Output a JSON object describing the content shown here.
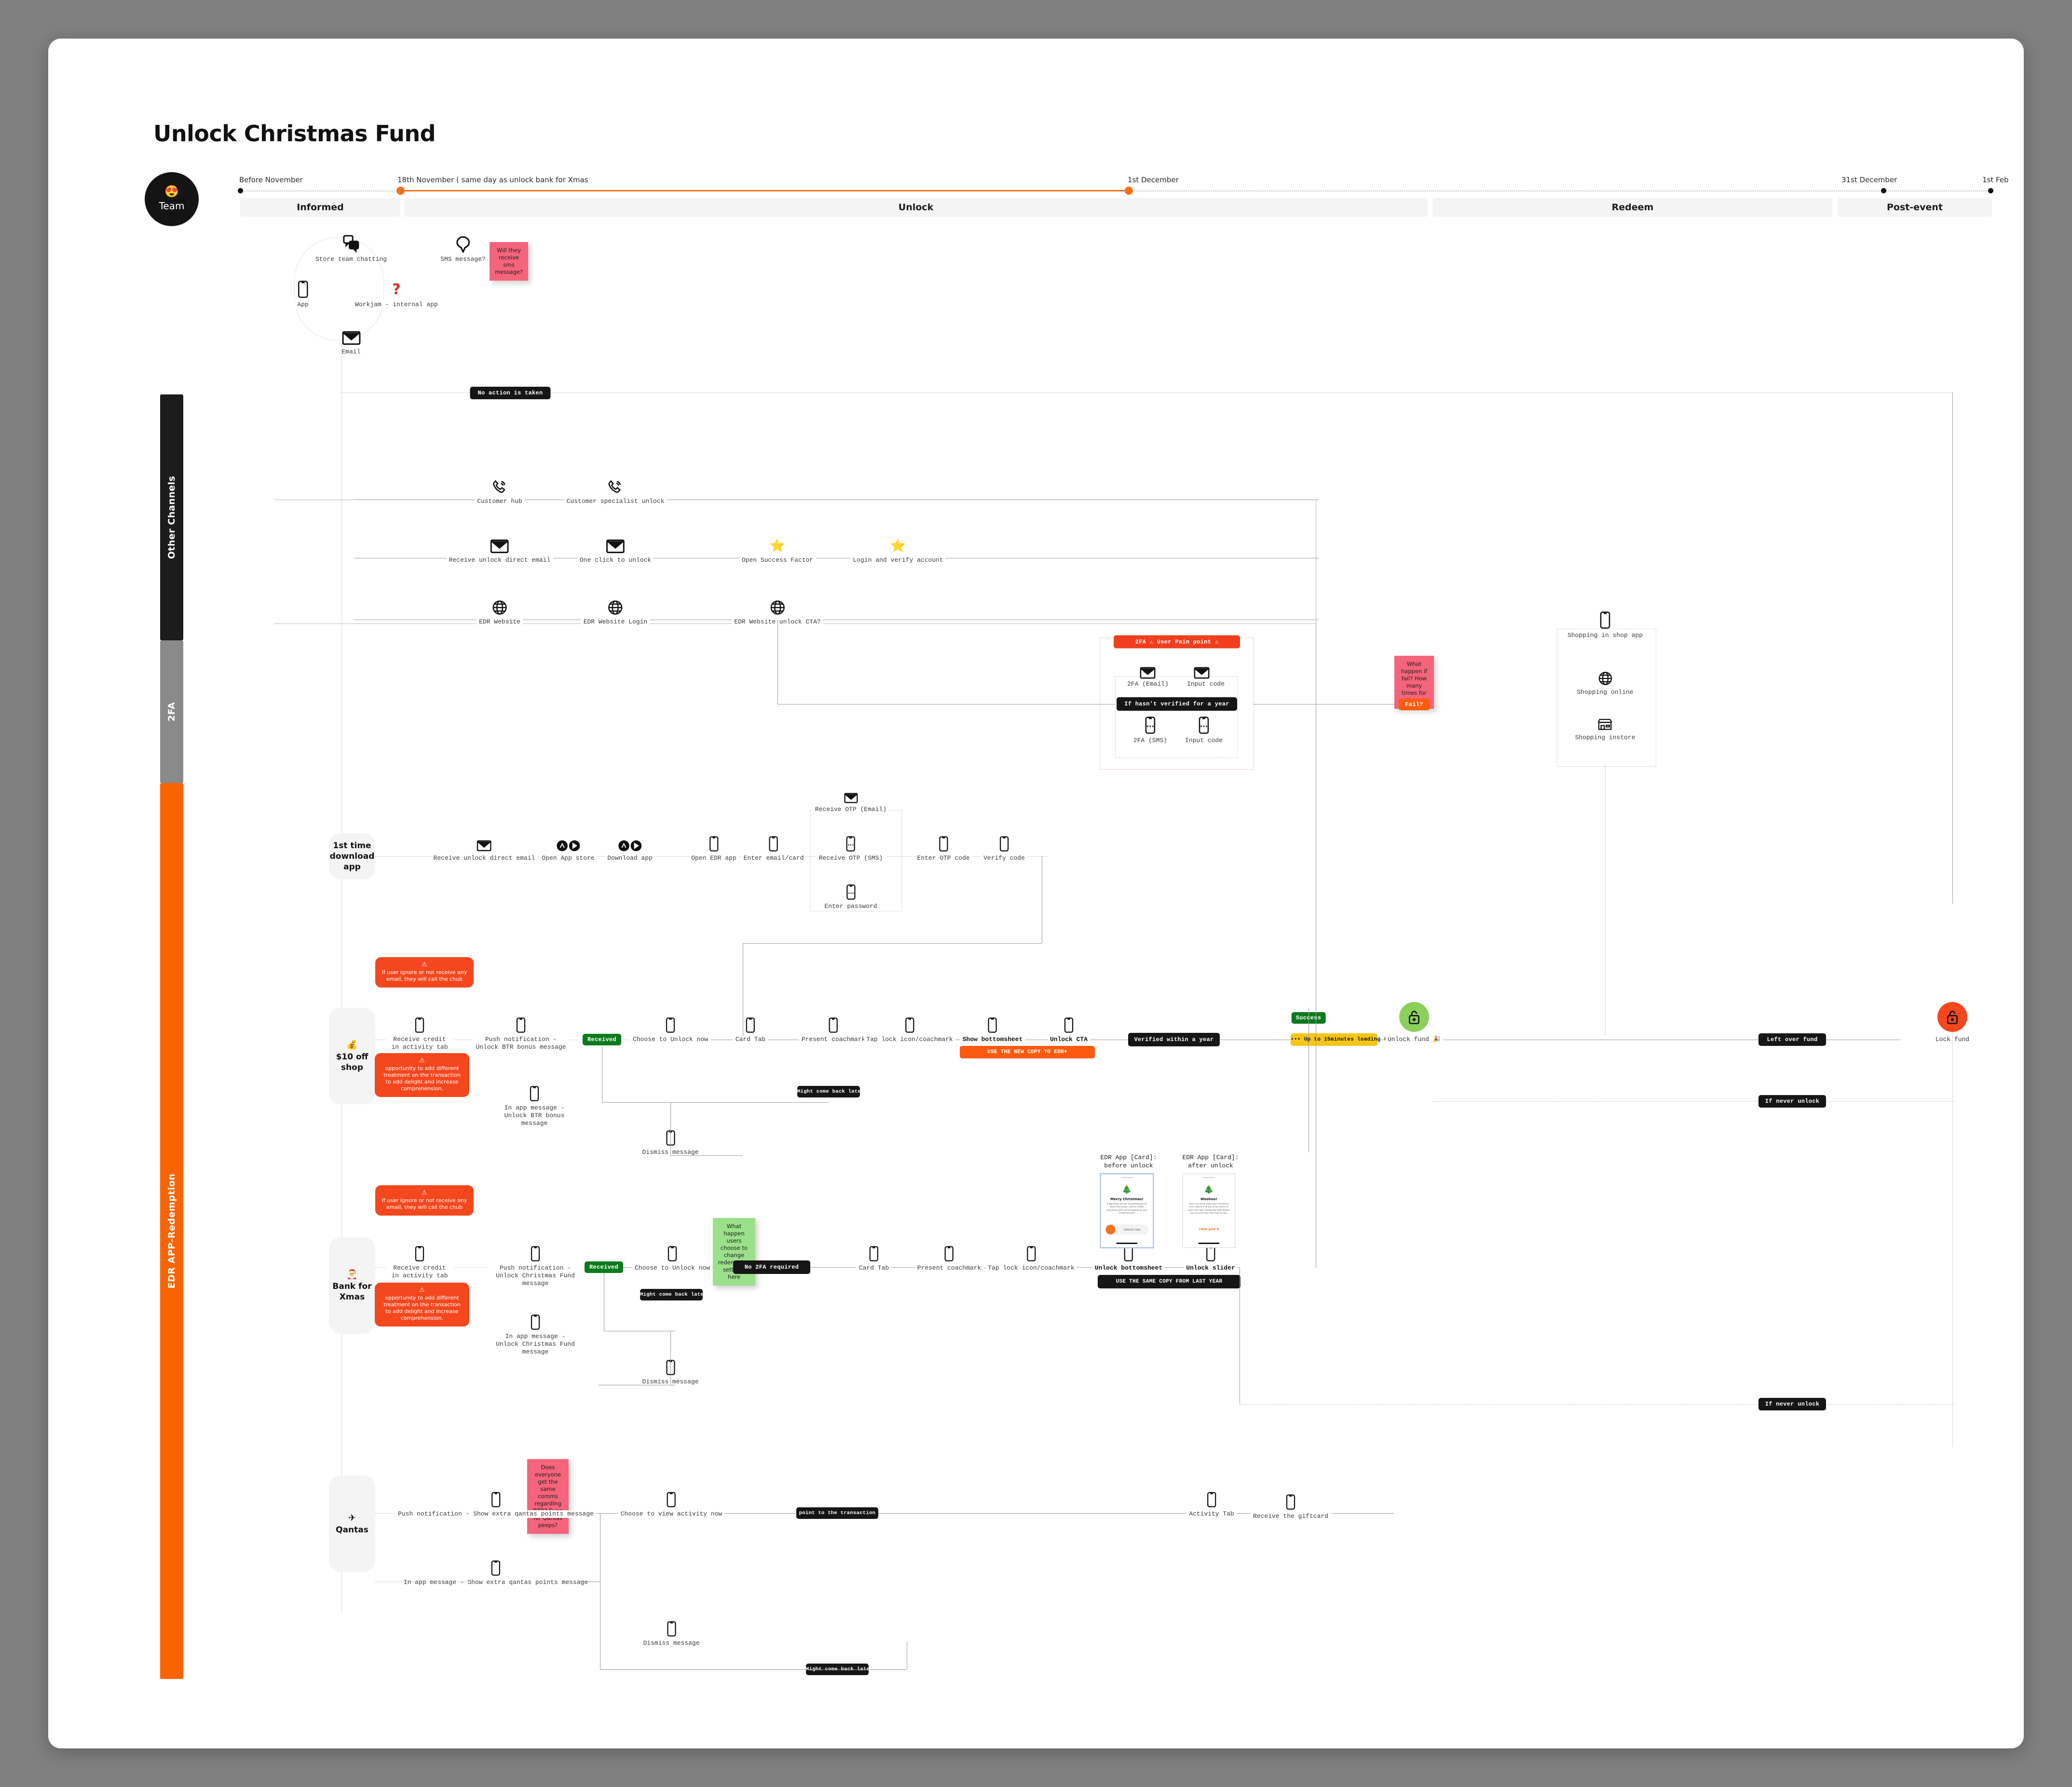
{
  "board": {
    "title": "Unlock Christmas Fund",
    "team": {
      "emoji": "😍",
      "label": "Team"
    }
  },
  "timeline": {
    "dates": [
      "Before November",
      "18th November ( same day as unlock bank for Xmas",
      "1st December",
      "31st December",
      "1st Feb"
    ],
    "phases": [
      "Informed",
      "Unlock",
      "Redeem",
      "Post-event"
    ],
    "accent": "#F2711C"
  },
  "lanes": [
    {
      "name": "Other  Channels",
      "color": "#1c1c1c"
    },
    {
      "name": "2FA",
      "color": "#8a8a8a"
    },
    {
      "name": "EDR APP-Redemption",
      "color": "#FA6400"
    }
  ],
  "informed": {
    "nodes": [
      {
        "icon": "chat-icon",
        "label": "Store team chatting"
      },
      {
        "icon": "phone-icon",
        "label": "App"
      },
      {
        "icon": "workjam-icon",
        "label": "Workjam - internal app"
      },
      {
        "icon": "email-icon",
        "label": "Email"
      },
      {
        "icon": "sms-bubble-icon",
        "label": "SMS message?"
      }
    ],
    "sticky": "Will they receive sms message?",
    "question_mark": "?"
  },
  "other_channels": {
    "badge_no_action": "No action is taken",
    "rows": [
      {
        "icon": "call-icon",
        "steps": [
          "Customer hub",
          "Customer specialist unlock"
        ]
      },
      {
        "icon": "email-icon",
        "steps": [
          "Receive unlock direct email",
          "One click to unlock",
          "Open Success Factor",
          "Login and verify account"
        ]
      },
      {
        "icon": "globe-icon",
        "steps": [
          "EDR Website",
          "EDR Website Login",
          "EDR Website unlock CTA?"
        ]
      }
    ]
  },
  "twofa": {
    "header": "2FA ⚠ User Pain point ⚠",
    "steps": [
      "2FA (Email)",
      "Input code",
      "2FA (SMS)",
      "Input code"
    ],
    "condition_pill": "If hasn't verified for a year",
    "fail_pill": "Fail?",
    "sticky": "What happen if fail? How many times for attempt"
  },
  "shopping": {
    "steps": [
      "Shopping in shop app",
      "Shopping online",
      "Shopping instore"
    ]
  },
  "first_time": {
    "stage": {
      "emoji": "",
      "label": "1st time download app"
    },
    "steps": [
      "Receive unlock direct email",
      "Open App store",
      "Download app",
      "Open EDR app",
      "Enter email/card",
      "Receive OTP (Email)",
      "Receive OTP (SMS)",
      "Enter password",
      "Enter OTP code",
      "Verify code"
    ]
  },
  "shop10": {
    "stage": {
      "emoji": "💰",
      "label": "$10 off shop"
    },
    "steps": [
      "Receive credit in activity tab",
      "Push notification - Unlock BTR bonus message",
      "Choose to Unlock now",
      "Card Tab",
      "Present coachmark",
      "Tap lock icon/coachmark",
      "Show bottomsheet",
      "Unlock CTA",
      "Unlock fund 🎉"
    ],
    "alt_steps": [
      "In app message - Unlock BTR bonus message",
      "Dismiss message"
    ],
    "pills": {
      "received": "Received",
      "might_come_back": "Might come back later",
      "use_new_copy": "USE THE NEW COPY TO EDR+",
      "verified": "Verified within a year",
      "loading": "••• Up to 15minutes loading time •••",
      "success": "Success",
      "left_over": "Left over fund",
      "if_never_unlock": "If never unlock"
    },
    "callouts": [
      "If user ignore or not receive any email, they will call the chub",
      "opportunity to add different treatment on the transaction to add delight and increase comprehension."
    ],
    "lock_label": "Lock fund"
  },
  "bank_xmas": {
    "stage": {
      "emoji": "🎅",
      "label": "Bank for Xmas"
    },
    "steps": [
      "Receive credit in activity tab",
      "Push notification - Unlock Christmas Fund message",
      "Choose to Unlock now",
      "Card Tab",
      "Present coachmark",
      "Tap lock icon/coachmark",
      "Unlock bottomsheet",
      "Unlock slider"
    ],
    "alt_steps": [
      "In app message - Unlock Christmas Fund message",
      "Dismiss message"
    ],
    "pills": {
      "received": "Received",
      "might_come_back": "Might come back later",
      "no_2fa": "No 2FA required",
      "same_copy": "USE THE SAME COPY FROM LAST YEAR",
      "if_never_unlock": "If never unlock"
    },
    "sticky_green": "What happen users choose to change redemption settings here",
    "callouts": [
      "If user ignore or not receive any email, they will call the chub",
      "opportunity to add different treatment on the transaction to add delight and increase comprehension."
    ],
    "mockups": [
      {
        "title": "EDR App [Card]:\nbefore unlock",
        "heading": "Merry Christmas!",
        "body": "A big thank you for everything you've done this season, and as a little something extra we've topped up your Christmas fund.",
        "cta": "Unlock now"
      },
      {
        "title": "EDR App [Card]:\nafter unlock",
        "heading": "Woohoo!",
        "body": "You're all set to enjoy your Christmas fund. Spend it at any of our stores or save it for later. Remember EDR Dollars top up to $5 and a bit more on top.",
        "link": "Little gold it"
      }
    ]
  },
  "qantas": {
    "stage": {
      "emoji": "✈",
      "label": "Qantas"
    },
    "steps": [
      "Push notification - Show extra qantas points message",
      "Choose to view activity now",
      "Activity Tab",
      "Receive the giftcard"
    ],
    "alt_steps": [
      "In app message - Show extra qantas points message",
      "Dismiss message"
    ],
    "pills": {
      "point_to_txn": "point to the transaction",
      "might_come_back": "Might come back later"
    },
    "sticky": "Does everyone get the same comms regarding BTR? Even for Qantas peeps?"
  }
}
